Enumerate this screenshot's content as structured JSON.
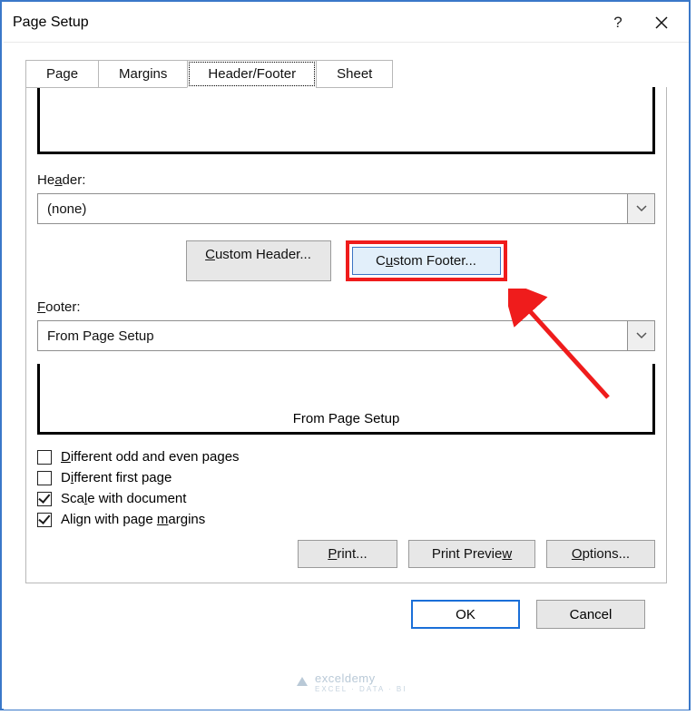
{
  "window": {
    "title": "Page Setup"
  },
  "tabs": {
    "page": "Page",
    "margins": "Margins",
    "headerfooter": "Header/Footer",
    "sheet": "Sheet"
  },
  "header": {
    "label_pre": "He",
    "label_ul": "a",
    "label_post": "der:",
    "value": "(none)"
  },
  "footer": {
    "label_ul": "F",
    "label_post": "ooter:",
    "value": "From Page Setup"
  },
  "buttons": {
    "custom_header_ul": "C",
    "custom_header_post": "ustom Header...",
    "custom_footer_pre": "C",
    "custom_footer_ul": "u",
    "custom_footer_post": "stom Footer..."
  },
  "footer_preview": "From Page Setup",
  "checks": {
    "diff_odd_ul": "D",
    "diff_odd_post": "ifferent odd and even pages",
    "diff_first_pre": "D",
    "diff_first_ul": "i",
    "diff_first_post": "fferent first page",
    "scale_pre": "Sca",
    "scale_ul": "l",
    "scale_post": "e with document",
    "align_pre": "Align with page ",
    "align_ul": "m",
    "align_post": "argins"
  },
  "bottom": {
    "print_ul": "P",
    "print_post": "rint...",
    "preview_pre": "Print Previe",
    "preview_ul": "w",
    "options_ul": "O",
    "options_post": "ptions..."
  },
  "dlg": {
    "ok": "OK",
    "cancel": "Cancel"
  },
  "watermark": {
    "name": "exceldemy",
    "sub": "EXCEL · DATA · BI"
  }
}
